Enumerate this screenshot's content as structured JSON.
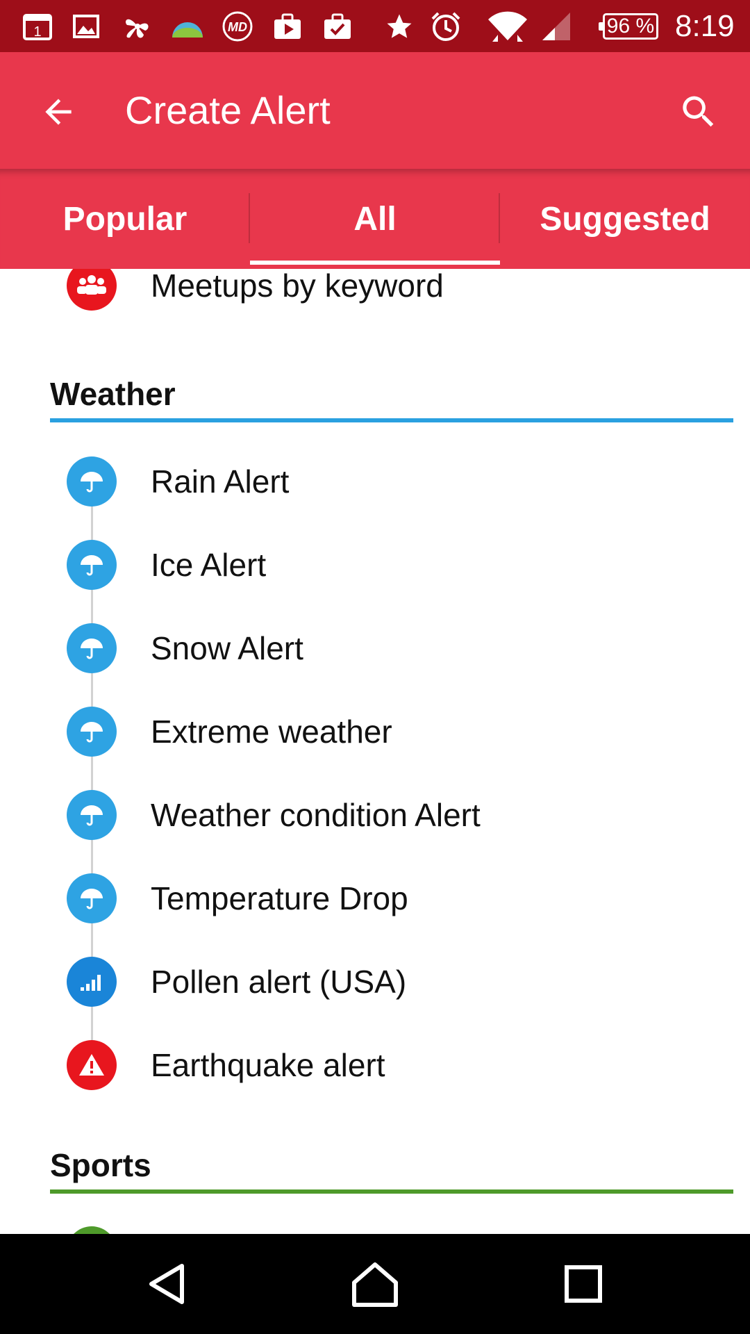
{
  "status_bar": {
    "battery": "96 %",
    "time": "8:19"
  },
  "app_bar": {
    "title": "Create Alert"
  },
  "tabs": [
    {
      "label": "Popular"
    },
    {
      "label": "All"
    },
    {
      "label": "Suggested"
    }
  ],
  "top_item": {
    "label": "Meetups by keyword"
  },
  "weather": {
    "title": "Weather",
    "accent": "#2aa0e0",
    "items": [
      {
        "label": "Rain Alert"
      },
      {
        "label": "Ice Alert"
      },
      {
        "label": "Snow Alert"
      },
      {
        "label": "Extreme weather"
      },
      {
        "label": "Weather condition Alert"
      },
      {
        "label": "Temperature Drop"
      },
      {
        "label": "Pollen alert (USA)"
      },
      {
        "label": "Earthquake alert"
      }
    ]
  },
  "sports": {
    "title": "Sports",
    "accent": "#4e9a2a"
  },
  "colors": {
    "status_bar": "#9e0e19",
    "app_bar": "#e8374c",
    "umbrella_badge": "#2ea3e3",
    "pollen_badge": "#1a85d8",
    "red_badge": "#e8161e"
  }
}
